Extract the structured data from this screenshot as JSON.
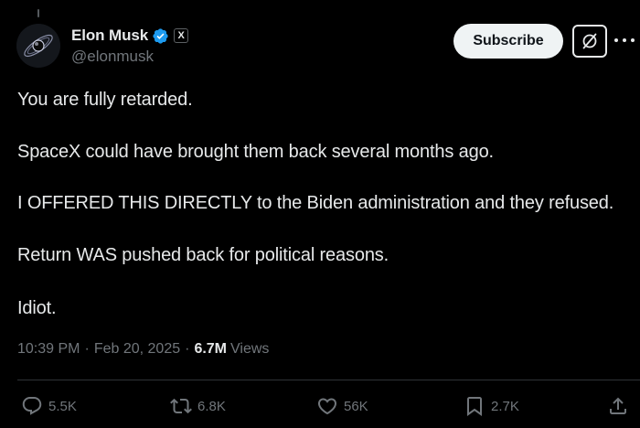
{
  "author": {
    "name": "Elon Musk",
    "handle": "@elonmusk",
    "affiliation_badge": "X",
    "verified": true,
    "verified_color": "#1d9bf0"
  },
  "header": {
    "subscribe_label": "Subscribe"
  },
  "post": {
    "lines": [
      "You are fully retarded.",
      "SpaceX could have brought them back several months ago.",
      "I OFFERED THIS DIRECTLY to the Biden administration and they refused.",
      "Return WAS pushed back for political reasons.",
      "Idiot."
    ]
  },
  "meta": {
    "time": "10:39 PM",
    "separator": "·",
    "date": "Feb 20, 2025",
    "views_count": "6.7M",
    "views_label": "Views"
  },
  "actions": {
    "replies": "5.5K",
    "reposts": "6.8K",
    "likes": "56K",
    "bookmarks": "2.7K"
  },
  "icons": {
    "avatar": "avatar-image",
    "verified": "verified-badge-icon",
    "grok": "grok-icon",
    "more": "more-icon",
    "reply": "reply-icon",
    "repost": "repost-icon",
    "like": "like-icon",
    "bookmark": "bookmark-icon",
    "share": "share-icon"
  },
  "colors": {
    "background": "#000000",
    "text_primary": "#e7e9ea",
    "text_secondary": "#71767b",
    "divider": "#2f3336"
  }
}
